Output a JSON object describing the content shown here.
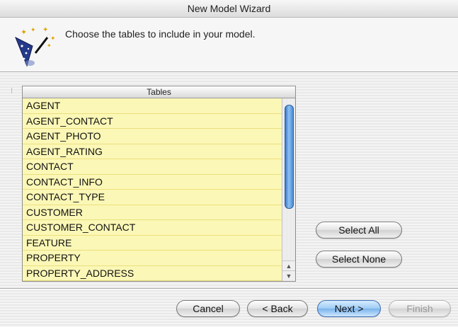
{
  "window": {
    "title": "New Model Wizard"
  },
  "header": {
    "prompt": "Choose the tables to include in your model.",
    "icon": "wizard-hat-wand-icon"
  },
  "table_list": {
    "header": "Tables",
    "rows": [
      "AGENT",
      "AGENT_CONTACT",
      "AGENT_PHOTO",
      "AGENT_RATING",
      "CONTACT",
      "CONTACT_INFO",
      "CONTACT_TYPE",
      "CUSTOMER",
      "CUSTOMER_CONTACT",
      "FEATURE",
      "PROPERTY",
      "PROPERTY_ADDRESS"
    ],
    "row_color": "#fbf7b6"
  },
  "side_buttons": {
    "select_all": "Select All",
    "select_none": "Select None"
  },
  "footer": {
    "cancel": "Cancel",
    "back": "< Back",
    "next": "Next >",
    "finish": "Finish"
  },
  "colors": {
    "accent": "#79b3ec",
    "scroll_thumb": "#3a74c4"
  }
}
